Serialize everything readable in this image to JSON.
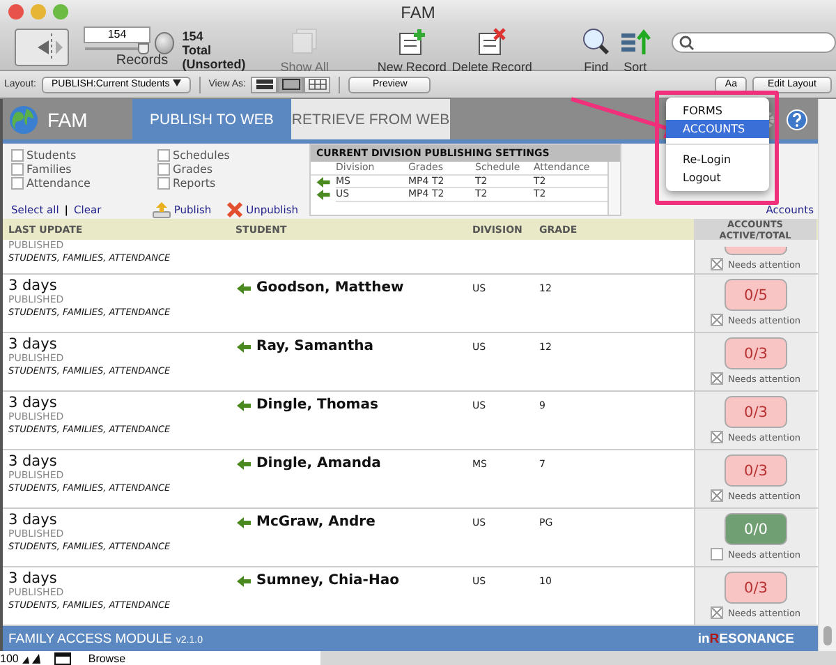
{
  "window": {
    "title": "FAM"
  },
  "toolbar": {
    "record_number": "154",
    "records_label": "Records",
    "record_slider": {
      "level": 1
    },
    "found_count": "154",
    "found_label": "Total (Unsorted)",
    "items": [
      {
        "label": "Show All",
        "kind": "showall",
        "disabled": true
      },
      {
        "label": "New Record",
        "kind": "new",
        "disabled": false
      },
      {
        "label": "Delete Record",
        "kind": "delete",
        "disabled": false
      },
      {
        "label": "Find",
        "kind": "find",
        "disabled": false
      },
      {
        "label": "Sort",
        "kind": "sort",
        "disabled": false
      }
    ]
  },
  "layout_bar": {
    "layout_label": "Layout:",
    "layout_value": "PUBLISH:Current Students",
    "view_label": "View As:",
    "views": [
      {
        "kind": "form",
        "selected": false
      },
      {
        "kind": "list",
        "selected": true
      },
      {
        "kind": "table",
        "selected": false
      }
    ],
    "preview": "Preview",
    "font_button": "Aa",
    "edit_layout": "Edit Layout"
  },
  "header": {
    "app_name": "FAM",
    "tabs": [
      {
        "label": "PUBLISH TO WEB",
        "selected": true
      },
      {
        "label": "RETRIEVE FROM WEB",
        "selected": false
      }
    ]
  },
  "publish_options": [
    {
      "label": "Students",
      "checked": false
    },
    {
      "label": "Families",
      "checked": false
    },
    {
      "label": "Attendance",
      "checked": false
    },
    {
      "label": "Schedules",
      "checked": false
    },
    {
      "label": "Grades",
      "checked": false
    },
    {
      "label": "Reports",
      "checked": false
    }
  ],
  "actions": {
    "select_all": "Select all",
    "separator": "|",
    "clear": "Clear",
    "publish": "Publish",
    "unpublish": "Unpublish"
  },
  "settings_table": {
    "title": "CURRENT DIVISION PUBLISHING SETTINGS",
    "columns": [
      "Division",
      "Grades",
      "Schedule",
      "Attendance"
    ],
    "rows": [
      [
        "MS",
        "MP4 T2",
        "T2",
        "T2"
      ],
      [
        "US",
        "MP4 T2",
        "T2",
        "T2"
      ]
    ]
  },
  "sync_accounts": "Accounts",
  "columns": {
    "last_update": "LAST UPDATE",
    "student": "STUDENT",
    "division": "DIVISION",
    "grade": "GRADE",
    "accounts": "ACCOUNTS ACTIVE/TOTAL"
  },
  "partial_row": {
    "status": "PUBLISHED",
    "fields": "STUDENTS, FAMILIES, ATTENDANCE",
    "attention_label": "Needs attention",
    "needs_attention": true
  },
  "rows": [
    {
      "last_update": "3 days",
      "status": "PUBLISHED",
      "fields": "STUDENTS, FAMILIES, ATTENDANCE",
      "student": "Goodson, Matthew",
      "division": "US",
      "grade": "12",
      "accounts": "0/5",
      "attention_label": "Needs attention",
      "needs_attention": true
    },
    {
      "last_update": "3 days",
      "status": "PUBLISHED",
      "fields": "STUDENTS, FAMILIES, ATTENDANCE",
      "student": "Ray, Samantha",
      "division": "US",
      "grade": "12",
      "accounts": "0/3",
      "attention_label": "Needs attention",
      "needs_attention": true
    },
    {
      "last_update": "3 days",
      "status": "PUBLISHED",
      "fields": "STUDENTS, FAMILIES, ATTENDANCE",
      "student": "Dingle, Thomas",
      "division": "US",
      "grade": "9",
      "accounts": "0/3",
      "attention_label": "Needs attention",
      "needs_attention": true
    },
    {
      "last_update": "3 days",
      "status": "PUBLISHED",
      "fields": "STUDENTS, FAMILIES, ATTENDANCE",
      "student": "Dingle, Amanda",
      "division": "MS",
      "grade": "7",
      "accounts": "0/3",
      "attention_label": "Needs attention",
      "needs_attention": true
    },
    {
      "last_update": "3 days",
      "status": "PUBLISHED",
      "fields": "STUDENTS, FAMILIES, ATTENDANCE",
      "student": "McGraw, Andre",
      "division": "US",
      "grade": "PG",
      "accounts": "0/0",
      "attention_label": "Needs attention",
      "needs_attention": false
    },
    {
      "last_update": "3 days",
      "status": "PUBLISHED",
      "fields": "STUDENTS, FAMILIES, ATTENDANCE",
      "student": "Sumney, Chia-Hao",
      "division": "US",
      "grade": "10",
      "accounts": "0/3",
      "attention_label": "Needs attention",
      "needs_attention": true
    }
  ],
  "footer": {
    "module": "FAMILY ACCESS MODULE",
    "version": "v2.1.0",
    "brand": {
      "prefix": "in",
      "mark": "R",
      "rest": "ESONANCE"
    }
  },
  "status_bar": {
    "zoom": "100",
    "mode": "Browse"
  },
  "menu": {
    "items": [
      {
        "label": "FORMS",
        "selected": false,
        "kind": "item"
      },
      {
        "label": "ACCOUNTS",
        "selected": true,
        "kind": "item"
      },
      {
        "kind": "separator"
      },
      {
        "label": "Re-Login",
        "selected": false,
        "kind": "item"
      },
      {
        "label": "Logout",
        "selected": false,
        "kind": "item"
      }
    ]
  }
}
